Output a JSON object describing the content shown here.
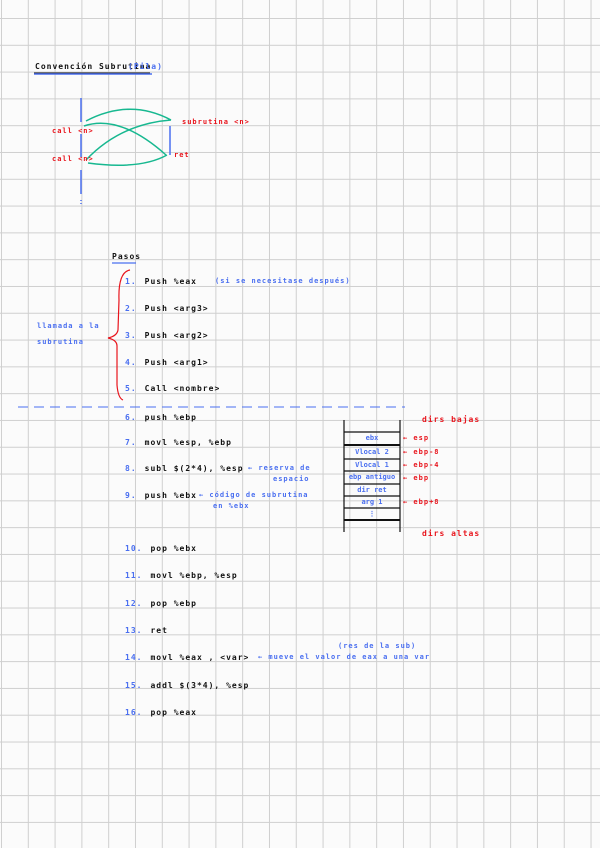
{
  "title": {
    "main": "Convención Subrutina",
    "paren": "(Pila)"
  },
  "diagram": {
    "call1": "call <n>",
    "call2": "call <n>",
    "sub": "subrutina <n>",
    "ret": "ret"
  },
  "pasos_title": "Pasos",
  "side_note": [
    "llamada a la",
    "subrutina"
  ],
  "steps": [
    {
      "n": "1.",
      "code": "Push %eax",
      "note": "(si se necesitase después)"
    },
    {
      "n": "2.",
      "code": "Push <arg3>"
    },
    {
      "n": "3.",
      "code": "Push <arg2>"
    },
    {
      "n": "4.",
      "code": "Push <arg1>"
    },
    {
      "n": "5.",
      "code": "Call <nombre>"
    },
    {
      "n": "6.",
      "code": "push %ebp"
    },
    {
      "n": "7.",
      "code": "movl %esp, %ebp"
    },
    {
      "n": "8.",
      "code": "subl $(2*4), %esp",
      "note": [
        "← reserva de",
        "espacio"
      ]
    },
    {
      "n": "9.",
      "code": "push %ebx",
      "note": [
        "← código de subrutina",
        "en %ebx"
      ]
    },
    {
      "n": "10.",
      "code": "pop %ebx"
    },
    {
      "n": "11.",
      "code": "movl %ebp, %esp"
    },
    {
      "n": "12.",
      "code": "pop %ebp"
    },
    {
      "n": "13.",
      "code": "ret"
    },
    {
      "n": "14.",
      "code": "movl %eax , <var>",
      "note": "← mueve el valor de eax a una var",
      "note2": "(res de la sub)"
    },
    {
      "n": "15.",
      "code": "addl $(3*4), %esp"
    },
    {
      "n": "16.",
      "code": "pop %eax"
    }
  ],
  "stack": {
    "top_label": "dirs bajas",
    "bottom_label": "dirs altas",
    "cells": [
      "ebx",
      "Vlocal 2",
      "Vlocal 1",
      "ebp antiguo",
      "dir ret",
      "arg 1",
      "⋮"
    ],
    "pointers": [
      "← esp",
      "← ebp-8",
      "← ebp-4",
      "← ebp",
      "← ebp+8"
    ]
  },
  "colors": {
    "ink": "#111111",
    "blue": "#4a6ff0",
    "red": "#e8141c",
    "green": "#17b890"
  }
}
